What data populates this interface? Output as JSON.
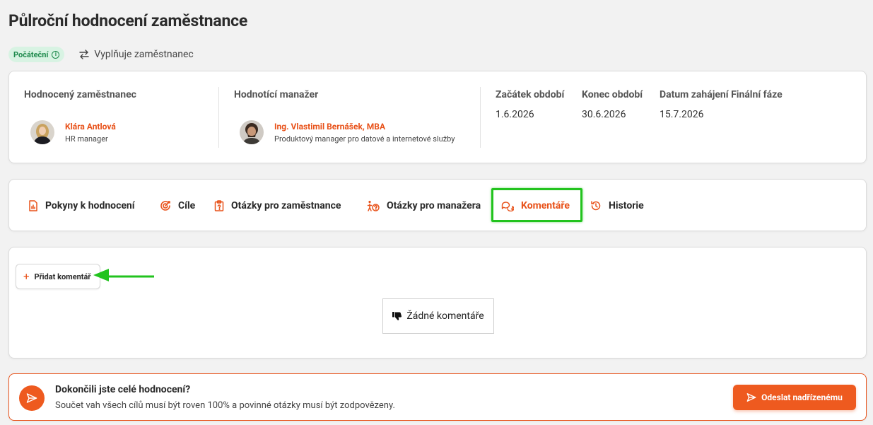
{
  "page": {
    "title": "Půlroční hodnocení zaměstnance"
  },
  "status": {
    "badge": "Počáteční",
    "info_glyph": "i",
    "filler": "Vyplňuje zaměstnanec"
  },
  "info": {
    "employee_label": "Hodnocený zaměstnanec",
    "employee_name": "Klára Antlová",
    "employee_role": "HR manager",
    "manager_label": "Hodnotící manažer",
    "manager_name": "Ing. Vlastimil Bernášek, MBA",
    "manager_role": "Produktový manager pro datové a internetové služby",
    "start_label": "Začátek období",
    "start_value": "1.6.2026",
    "end_label": "Konec období",
    "end_value": "30.6.2026",
    "final_label": "Datum zahájení Finální fáze",
    "final_value": "15.7.2026"
  },
  "tabs": [
    {
      "label": "Pokyny k hodnocení",
      "icon": "document-chart-icon"
    },
    {
      "label": "Cíle",
      "icon": "target-icon"
    },
    {
      "label": "Otázky pro zaměstnance",
      "icon": "clipboard-icon"
    },
    {
      "label": "Otázky pro manažera",
      "icon": "manager-question-icon"
    },
    {
      "label": "Komentáře",
      "icon": "chat-bubbles-icon",
      "active": true
    },
    {
      "label": "Historie",
      "icon": "history-icon"
    }
  ],
  "comments": {
    "add_label": "Přidat komentář",
    "add_glyph": "+",
    "empty_label": "Žádné komentáře"
  },
  "submit": {
    "title": "Dokončili jste celé hodnocení?",
    "description": "Součet vah všech cílů musí být roven 100% a povinné otázky musí být zodpovězeny.",
    "button_label": "Odeslat nadřízenému"
  },
  "colors": {
    "accent": "#e8521a",
    "button": "#ee5a1f",
    "highlight": "#22c31e",
    "badge_bg": "#d8f3e3",
    "badge_fg": "#1f8a4d"
  }
}
